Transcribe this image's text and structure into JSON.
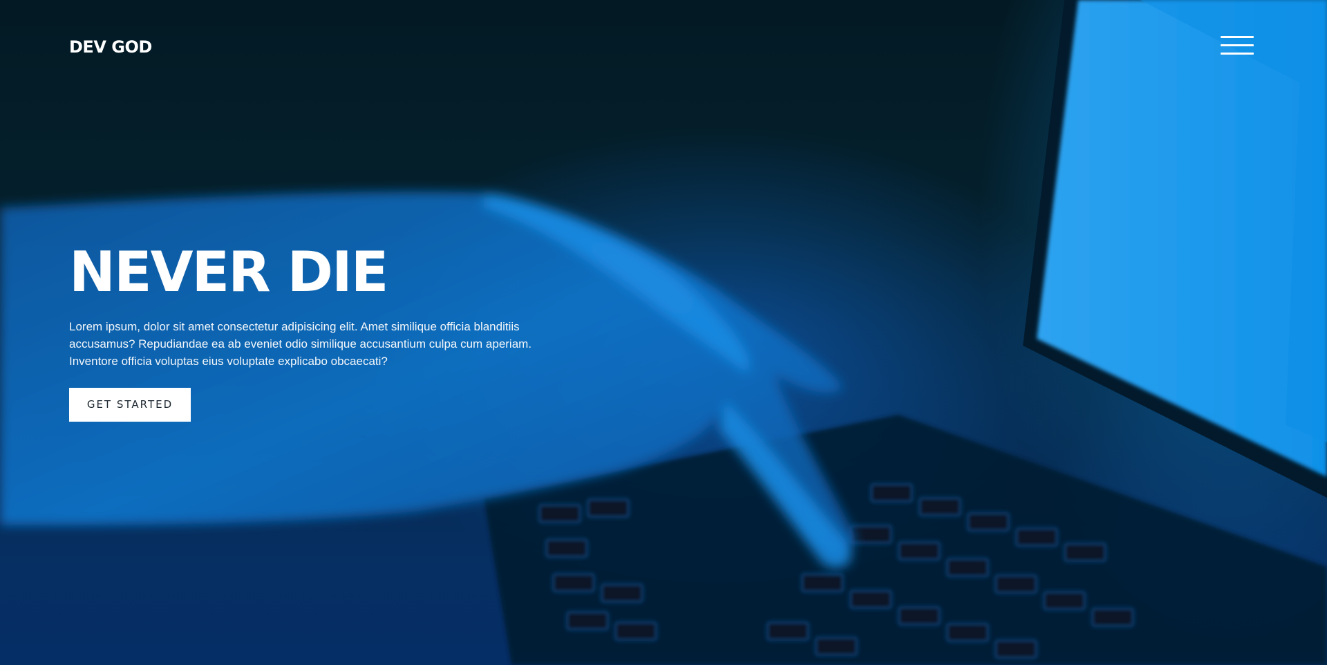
{
  "header": {
    "logo": "DEV GOD",
    "menu_icon": "hamburger-menu-icon"
  },
  "hero": {
    "title": "NEVER DIE",
    "description": "Lorem ipsum, dolor sit amet consectetur adipisicing elit. Amet similique officia blanditiis accusamus? Repudiandae ea ab eveniet odio similique accusantium culpa cum aperiam. Inventore officia voluptas eius voluptate explicabo obcaecati?",
    "cta_label": "GET STARTED"
  },
  "colors": {
    "accent_blue": "#1a8fe6",
    "dark_bg": "#031a24",
    "button_bg": "#ffffff",
    "button_text": "#1d2730"
  }
}
